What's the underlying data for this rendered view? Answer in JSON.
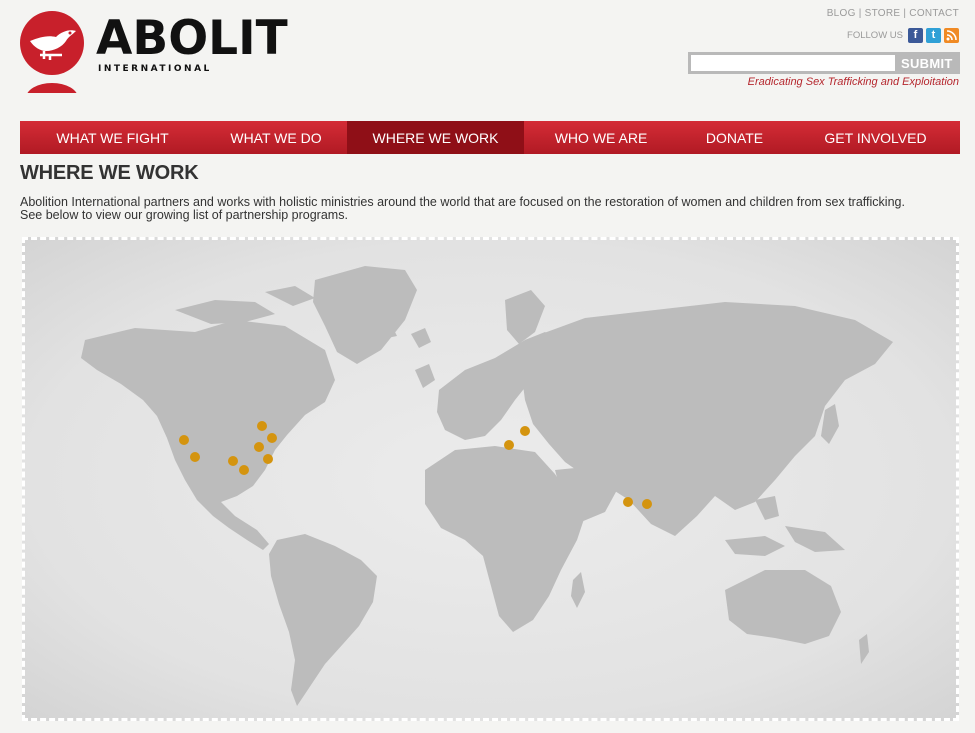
{
  "header": {
    "logo_text": "ABOLITIO",
    "logo_subtext": "INTERNATIONAL",
    "top_links": [
      "BLOG",
      "STORE",
      "CONTACT"
    ],
    "follow_label": "FOLLOW US",
    "social_icons": [
      "facebook-icon",
      "twitter-icon",
      "rss-icon"
    ],
    "search_value": "",
    "search_button": "SUBMIT",
    "tagline": "Eradicating Sex Trafficking and Exploitation"
  },
  "nav": {
    "items": [
      "WHAT WE FIGHT",
      "WHAT WE DO",
      "WHERE WE WORK",
      "WHO WE ARE",
      "DONATE",
      "GET INVOLVED"
    ],
    "active_index": 2
  },
  "main": {
    "title": "WHERE WE WORK",
    "intro_line1": "Abolition International partners and works with holistic ministries around the world that are focused on the restoration of women and children from sex trafficking.",
    "intro_line2": "See below to view our growing list of partnership programs."
  },
  "colors": {
    "brand_red": "#c8202b",
    "nav_active": "#8f0f17",
    "location_marker": "#d4940f",
    "land": "#bdbdbd"
  }
}
